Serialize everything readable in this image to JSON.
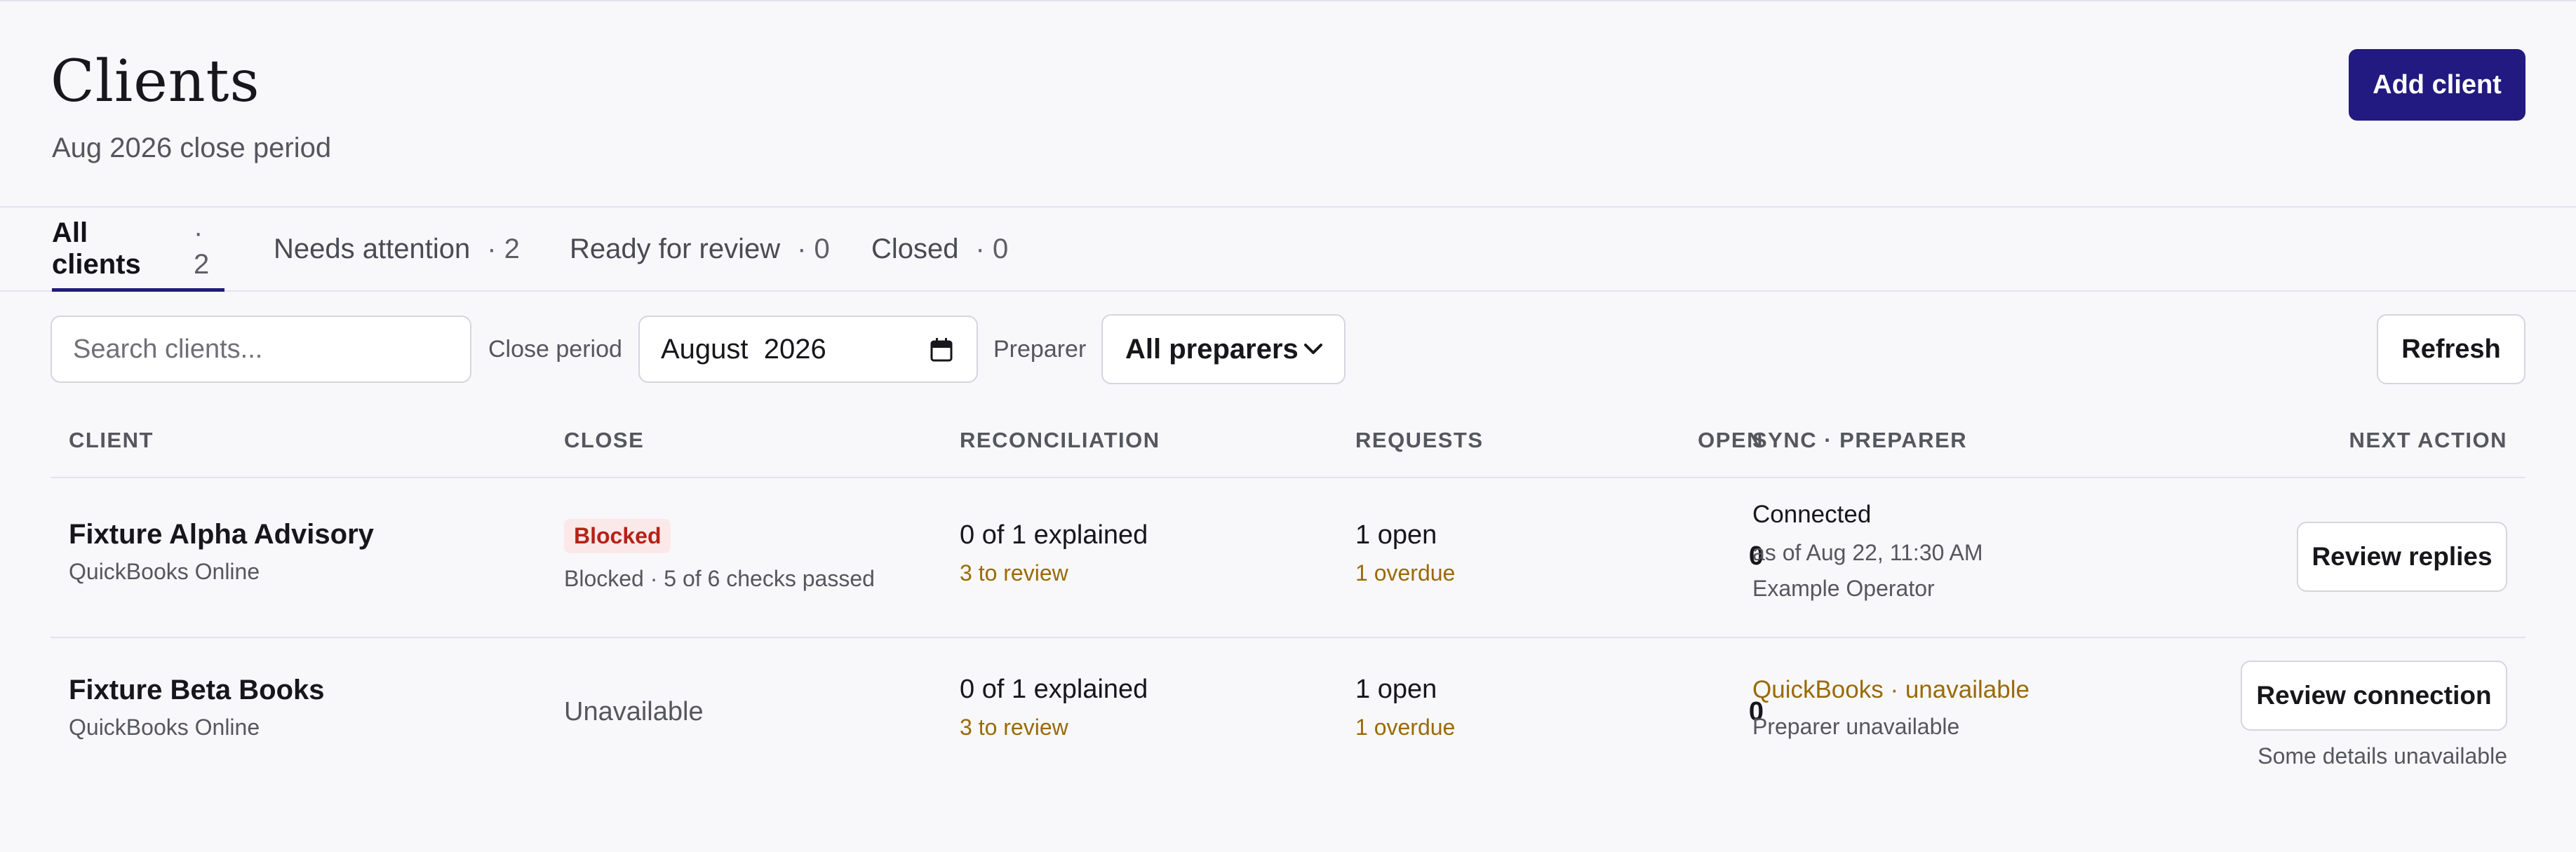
{
  "header": {
    "title": "Clients",
    "subtitle": "Aug 2026 close period",
    "add_client_label": "Add client"
  },
  "tabs": [
    {
      "label": "All clients",
      "count": "· 2",
      "active": true
    },
    {
      "label": "Needs attention",
      "count": "· 2",
      "active": false
    },
    {
      "label": "Ready for review",
      "count": "· 0",
      "active": false
    },
    {
      "label": "Closed",
      "count": "· 0",
      "active": false
    }
  ],
  "filters": {
    "search_placeholder": "Search clients...",
    "close_period_label": "Close period",
    "close_period_value": "August  2026",
    "preparer_label": "Preparer",
    "preparer_value": "All preparers",
    "refresh_label": "Refresh"
  },
  "table": {
    "columns": [
      "CLIENT",
      "CLOSE",
      "RECONCILIATION",
      "REQUESTS",
      "OPEN",
      "SYNC · PREPARER",
      "NEXT ACTION"
    ],
    "rows": [
      {
        "client_name": "Fixture Alpha Advisory",
        "client_source": "QuickBooks Online",
        "close_badge": "Blocked",
        "close_detail": "Blocked · 5 of 6 checks passed",
        "reconciliation": "0 of 1 explained",
        "reconciliation_review": "3 to review",
        "requests": "1 open",
        "requests_overdue": "1 overdue",
        "open": "0",
        "sync_status": "Connected",
        "sync_time": "as of Aug 22, 11:30 AM",
        "preparer": "Example Operator",
        "next_action": "Review replies"
      },
      {
        "client_name": "Fixture Beta Books",
        "client_source": "QuickBooks Online",
        "close_status": "Unavailable",
        "reconciliation": "0 of 1 explained",
        "reconciliation_review": "3 to review",
        "requests": "1 open",
        "requests_overdue": "1 overdue",
        "open": "0",
        "sync_status": "QuickBooks · unavailable",
        "preparer": "Preparer unavailable",
        "next_action": "Review connection",
        "next_action_note": "Some details unavailable"
      }
    ]
  },
  "colors": {
    "accent": "#221a80",
    "warning": "#9a6a07",
    "danger": "#b42318",
    "danger_bg": "#fbe9e9"
  },
  "icons": {
    "date_picker": "calendar-icon",
    "preparer_select": "chevron-down-icon"
  }
}
